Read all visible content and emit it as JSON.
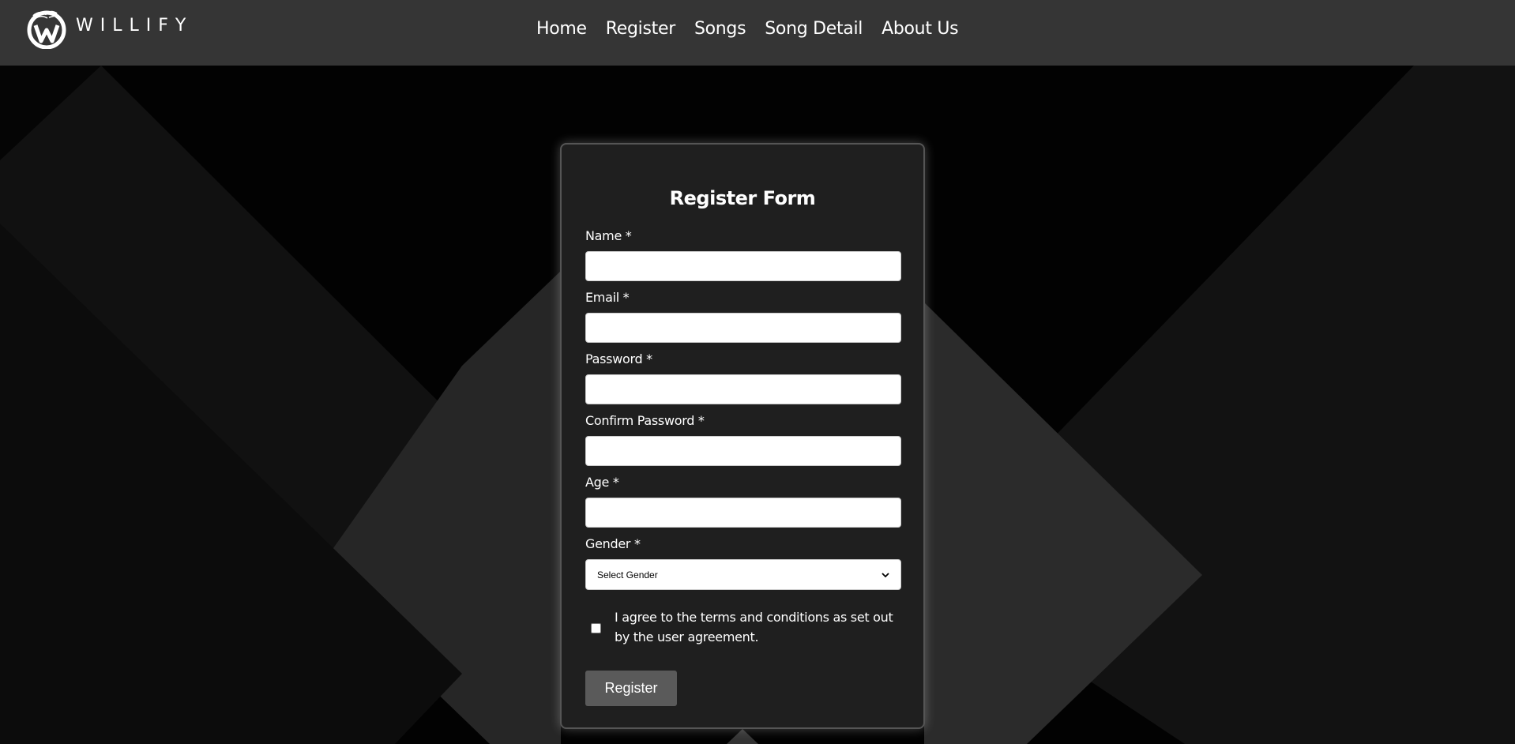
{
  "brand": {
    "name": "WILLIFY",
    "logo_icon": "willify-logo-icon"
  },
  "nav": {
    "items": [
      {
        "label": "Home"
      },
      {
        "label": "Register"
      },
      {
        "label": "Songs"
      },
      {
        "label": "Song Detail"
      },
      {
        "label": "About Us"
      }
    ]
  },
  "form": {
    "title": "Register Form",
    "fields": [
      {
        "label": "Name *",
        "value": "",
        "type": "text"
      },
      {
        "label": "Email *",
        "value": "",
        "type": "email"
      },
      {
        "label": "Password *",
        "value": "",
        "type": "password"
      },
      {
        "label": "Confirm Password *",
        "value": "",
        "type": "password"
      },
      {
        "label": "Age *",
        "value": "",
        "type": "number"
      }
    ],
    "gender": {
      "label": "Gender *",
      "selected": "Select Gender"
    },
    "agreement": {
      "checked": false,
      "text": "I agree to the terms and conditions as set out by the user agreement."
    },
    "submit_label": "Register"
  },
  "colors": {
    "navbar_bg": "#353535",
    "card_bg": "#1f1f1f",
    "button_bg": "#5a5a5a",
    "page_bg": "#000000"
  }
}
